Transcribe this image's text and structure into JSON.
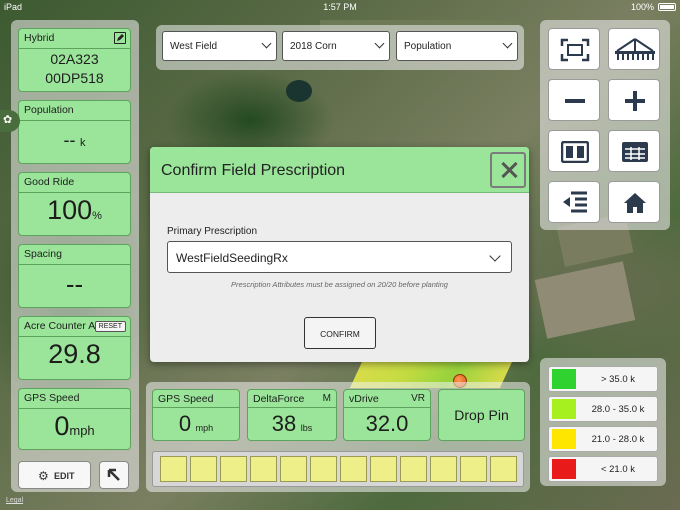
{
  "status_bar": {
    "device": "iPad",
    "time": "1:57 PM",
    "battery": "100%"
  },
  "top_selectors": [
    {
      "value": "West Field"
    },
    {
      "value": "2018 Corn"
    },
    {
      "value": "Population"
    }
  ],
  "left_tiles": {
    "hybrid": {
      "label": "Hybrid",
      "line1": "02A323",
      "line2": "00DP518"
    },
    "population": {
      "label": "Population",
      "value": "--",
      "unit": "k"
    },
    "good_ride": {
      "label": "Good Ride",
      "value": "100",
      "unit": "%"
    },
    "spacing": {
      "label": "Spacing",
      "value": "--"
    },
    "acre_counter": {
      "label": "Acre Counter A",
      "reset_label": "RESET",
      "value": "29.8"
    },
    "gps_speed": {
      "label": "GPS Speed",
      "value": "0",
      "unit": "mph"
    }
  },
  "edit_button": {
    "label": "EDIT"
  },
  "bottom_tiles": {
    "gps_speed": {
      "label": "GPS Speed",
      "value": "0",
      "unit": "mph"
    },
    "deltaforce": {
      "label": "DeltaForce",
      "badge": "M",
      "value": "38",
      "unit": "lbs"
    },
    "vdrive": {
      "label": "vDrive",
      "badge": "VR",
      "value": "32.0"
    },
    "drop_pin": {
      "label": "Drop Pin"
    }
  },
  "row_unit_count": 12,
  "legend": [
    {
      "label": "> 35.0 k",
      "color": "#2fd22f"
    },
    {
      "label": "28.0 - 35.0 k",
      "color": "#a6f01f"
    },
    {
      "label": "21.0 - 28.0 k",
      "color": "#ffe600"
    },
    {
      "label": "< 21.0 k",
      "color": "#e81a1a"
    }
  ],
  "modal": {
    "title": "Confirm Field Prescription",
    "field_label": "Primary Prescription",
    "selected_value": "WestFieldSeedingRx",
    "note": "Prescription Attributes must be assigned on 20/20 before planting",
    "confirm_label": "CONFIRM"
  },
  "map_credit": "Legal"
}
